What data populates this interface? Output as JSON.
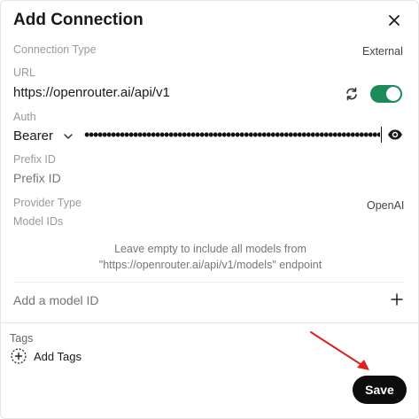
{
  "dialog": {
    "title": "Add Connection",
    "close_icon": "close-icon"
  },
  "connection_type": {
    "label": "Connection Type",
    "value": "External"
  },
  "url": {
    "label": "URL",
    "value": "https://openrouter.ai/api/v1",
    "enabled": true
  },
  "auth": {
    "label": "Auth",
    "type": "Bearer",
    "masked_key": "••••••••••••••••••••••••••••••••••••••••••••••••••••••••••••••••••••••••••••••••"
  },
  "prefix": {
    "label": "Prefix ID",
    "placeholder": "Prefix ID"
  },
  "provider": {
    "label": "Provider Type",
    "value": "OpenAI"
  },
  "model_ids": {
    "label": "Model IDs",
    "hint": "Leave empty to include all models from \"https://openrouter.ai/api/v1/models\" endpoint",
    "placeholder": "Add a model ID"
  },
  "tags": {
    "label": "Tags",
    "add_label": "Add Tags"
  },
  "actions": {
    "save_label": "Save"
  },
  "colors": {
    "toggle_on": "#1d8a5a",
    "save_bg": "#0d0d0d",
    "annotation_arrow": "#e02020"
  }
}
